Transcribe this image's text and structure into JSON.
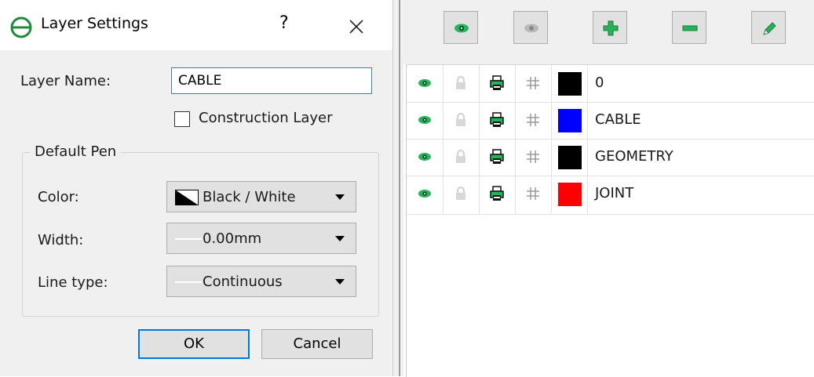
{
  "dialog": {
    "title": "Layer Settings",
    "help_label": "?",
    "layer_name_label": "Layer Name:",
    "layer_name_value": "CABLE",
    "construction_layer_label": "Construction Layer",
    "construction_layer_checked": false,
    "default_pen_title": "Default Pen",
    "color_label": "Color:",
    "color_value": "Black / White",
    "width_label": "Width:",
    "width_value": "0.00mm",
    "linetype_label": "Line type:",
    "linetype_value": "Continuous",
    "ok_label": "OK",
    "cancel_label": "Cancel"
  },
  "toolbar": {
    "buttons": [
      {
        "icon": "show-all-layers-icon"
      },
      {
        "icon": "hide-all-layers-icon"
      },
      {
        "icon": "add-layer-icon"
      },
      {
        "icon": "remove-layer-icon"
      },
      {
        "icon": "edit-layer-icon"
      }
    ]
  },
  "layers": [
    {
      "name": "0",
      "color": "#000000"
    },
    {
      "name": "CABLE",
      "color": "#0000ff"
    },
    {
      "name": "GEOMETRY",
      "color": "#000000"
    },
    {
      "name": "JOINT",
      "color": "#ff0000"
    }
  ],
  "colors": {
    "accent_green": "#27b35a",
    "focus_blue": "#0078d7"
  }
}
